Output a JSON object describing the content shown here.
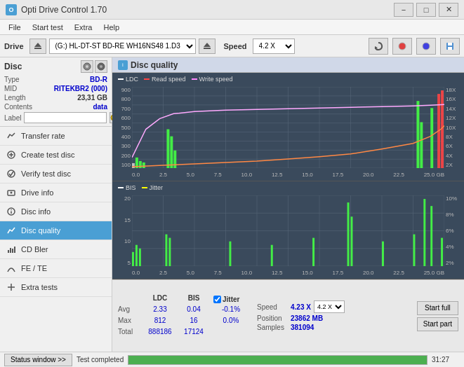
{
  "app": {
    "title": "Opti Drive Control 1.70",
    "logo_text": "O"
  },
  "titlebar": {
    "minimize_label": "−",
    "maximize_label": "□",
    "close_label": "✕"
  },
  "menubar": {
    "items": [
      "File",
      "Start test",
      "Extra",
      "Help"
    ]
  },
  "drive_toolbar": {
    "drive_label": "Drive",
    "drive_value": "(G:)  HL-DT-ST BD-RE  WH16NS48 1.D3",
    "speed_label": "Speed",
    "speed_value": "4.2 X"
  },
  "disc_panel": {
    "title": "Disc",
    "type_label": "Type",
    "type_value": "BD-R",
    "mid_label": "MID",
    "mid_value": "RITEKBR2 (000)",
    "length_label": "Length",
    "length_value": "23,31 GB",
    "contents_label": "Contents",
    "contents_value": "data",
    "label_label": "Label",
    "label_value": ""
  },
  "nav_items": [
    {
      "id": "transfer-rate",
      "label": "Transfer rate",
      "active": false
    },
    {
      "id": "create-test-disc",
      "label": "Create test disc",
      "active": false
    },
    {
      "id": "verify-test-disc",
      "label": "Verify test disc",
      "active": false
    },
    {
      "id": "drive-info",
      "label": "Drive info",
      "active": false
    },
    {
      "id": "disc-info",
      "label": "Disc info",
      "active": false
    },
    {
      "id": "disc-quality",
      "label": "Disc quality",
      "active": true
    },
    {
      "id": "cd-bler",
      "label": "CD Bler",
      "active": false
    },
    {
      "id": "fe-te",
      "label": "FE / TE",
      "active": false
    },
    {
      "id": "extra-tests",
      "label": "Extra tests",
      "active": false
    }
  ],
  "content": {
    "header_title": "Disc quality",
    "chart1": {
      "legend": [
        {
          "label": "LDC",
          "color": "#ffffff"
        },
        {
          "label": "Read speed",
          "color": "#ff4444"
        },
        {
          "label": "Write speed",
          "color": "#ff88ff"
        }
      ],
      "y_labels_left": [
        "900",
        "800",
        "700",
        "600",
        "500",
        "400",
        "300",
        "200",
        "100"
      ],
      "y_labels_right": [
        "18X",
        "16X",
        "14X",
        "12X",
        "10X",
        "8X",
        "6X",
        "4X",
        "2X"
      ],
      "x_labels": [
        "0.0",
        "2.5",
        "5.0",
        "7.5",
        "10.0",
        "12.5",
        "15.0",
        "17.5",
        "20.0",
        "22.5",
        "25.0 GB"
      ]
    },
    "chart2": {
      "legend": [
        {
          "label": "BIS",
          "color": "#ffffff"
        },
        {
          "label": "Jitter",
          "color": "#ffff00"
        }
      ],
      "y_labels_left": [
        "20",
        "15",
        "10",
        "5"
      ],
      "y_labels_right": [
        "10%",
        "8%",
        "6%",
        "4%",
        "2%"
      ],
      "x_labels": [
        "0.0",
        "2.5",
        "5.0",
        "7.5",
        "10.0",
        "12.5",
        "15.0",
        "17.5",
        "20.0",
        "22.5",
        "25.0 GB"
      ]
    }
  },
  "stats": {
    "ldc_header": "LDC",
    "bis_header": "BIS",
    "jitter_header": "Jitter",
    "avg_label": "Avg",
    "max_label": "Max",
    "total_label": "Total",
    "ldc_avg": "2.33",
    "ldc_max": "812",
    "ldc_total": "888186",
    "bis_avg": "0.04",
    "bis_max": "16",
    "bis_total": "17124",
    "jitter_avg": "-0.1%",
    "jitter_max": "0.0%",
    "jitter_total": "",
    "speed_label": "Speed",
    "speed_value": "4.23 X",
    "speed_select": "4.2 X",
    "position_label": "Position",
    "position_value": "23862 MB",
    "samples_label": "Samples",
    "samples_value": "381094",
    "start_full_label": "Start full",
    "start_part_label": "Start part"
  },
  "statusbar": {
    "button_label": "Status window >>",
    "status_text": "Test completed",
    "progress_percent": 100,
    "time_text": "31:27"
  }
}
